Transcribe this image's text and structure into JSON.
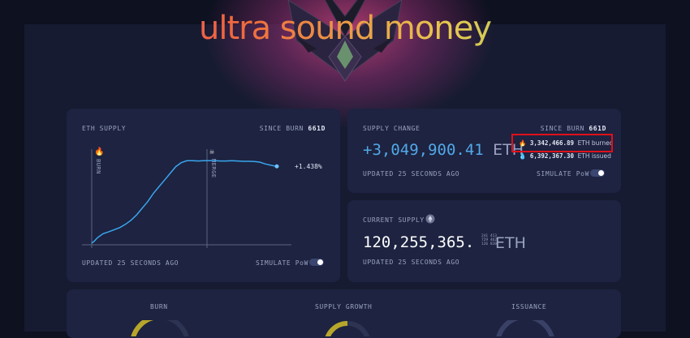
{
  "hero": {
    "title": "ultra sound money"
  },
  "eth_supply_card": {
    "label": "ETH SUPPLY",
    "since_label": "SINCE BURN",
    "since_value": "661d",
    "burn_marker": "BURN",
    "merge_marker": "MERGE",
    "rate": "+1.438%/y",
    "updated": "UPDATED 25 SECONDS AGO",
    "simulate": "SIMULATE PoW",
    "burn_icon": "fire-icon",
    "merge_icon": "skull-icon"
  },
  "supply_change_card": {
    "label": "SUPPLY CHANGE",
    "since_label": "SINCE BURN",
    "since_value": "661d",
    "value": "+3,049,900.41",
    "unit": "ETH",
    "burned_value": "3,342,466.89",
    "burned_unit": "ETH burned",
    "issued_value": "6,392,367.30",
    "issued_unit": "ETH issued",
    "updated": "UPDATED 25 SECONDS AGO",
    "simulate": "SIMULATE PoW"
  },
  "current_supply_card": {
    "label": "CURRENT SUPPLY",
    "value": "120,255,365.",
    "decimals_top": "241 413",
    "decimals_mid": "729 462",
    "decimals_bot": "126 820",
    "unit": "ETH",
    "updated": "UPDATED 25 SECONDS AGO"
  },
  "bottom_card": {
    "burn": "BURN",
    "supply_growth": "SUPPLY GROWTH",
    "issuance": "ISSUANCE"
  },
  "chart_data": {
    "type": "line",
    "x": [
      0,
      10,
      20,
      40,
      60,
      80,
      100,
      120,
      140,
      160,
      180,
      200,
      220,
      240,
      260,
      280,
      300,
      320,
      340,
      360,
      380,
      400,
      420,
      440,
      460,
      480,
      500,
      520,
      540,
      560,
      580,
      600,
      620,
      640,
      661
    ],
    "y": [
      0,
      0.08,
      0.2,
      0.35,
      0.42,
      0.5,
      0.58,
      0.7,
      0.85,
      1.05,
      1.3,
      1.55,
      1.85,
      2.1,
      2.35,
      2.6,
      2.85,
      3.0,
      3.07,
      3.07,
      3.06,
      3.07,
      3.07,
      3.07,
      3.06,
      3.06,
      3.07,
      3.06,
      3.05,
      3.05,
      3.04,
      3.02,
      2.95,
      2.9,
      2.86
    ],
    "markers": [
      "BURN",
      "MERGE"
    ],
    "annotation": "+1.438%/y",
    "colors": {
      "line": "#3aa5ee",
      "axis": "#6b7392"
    }
  },
  "colors": {
    "accent_blue": "#4fa6e8",
    "highlight_red": "#e0101a",
    "gauge_yellow": "#b8a62a"
  }
}
